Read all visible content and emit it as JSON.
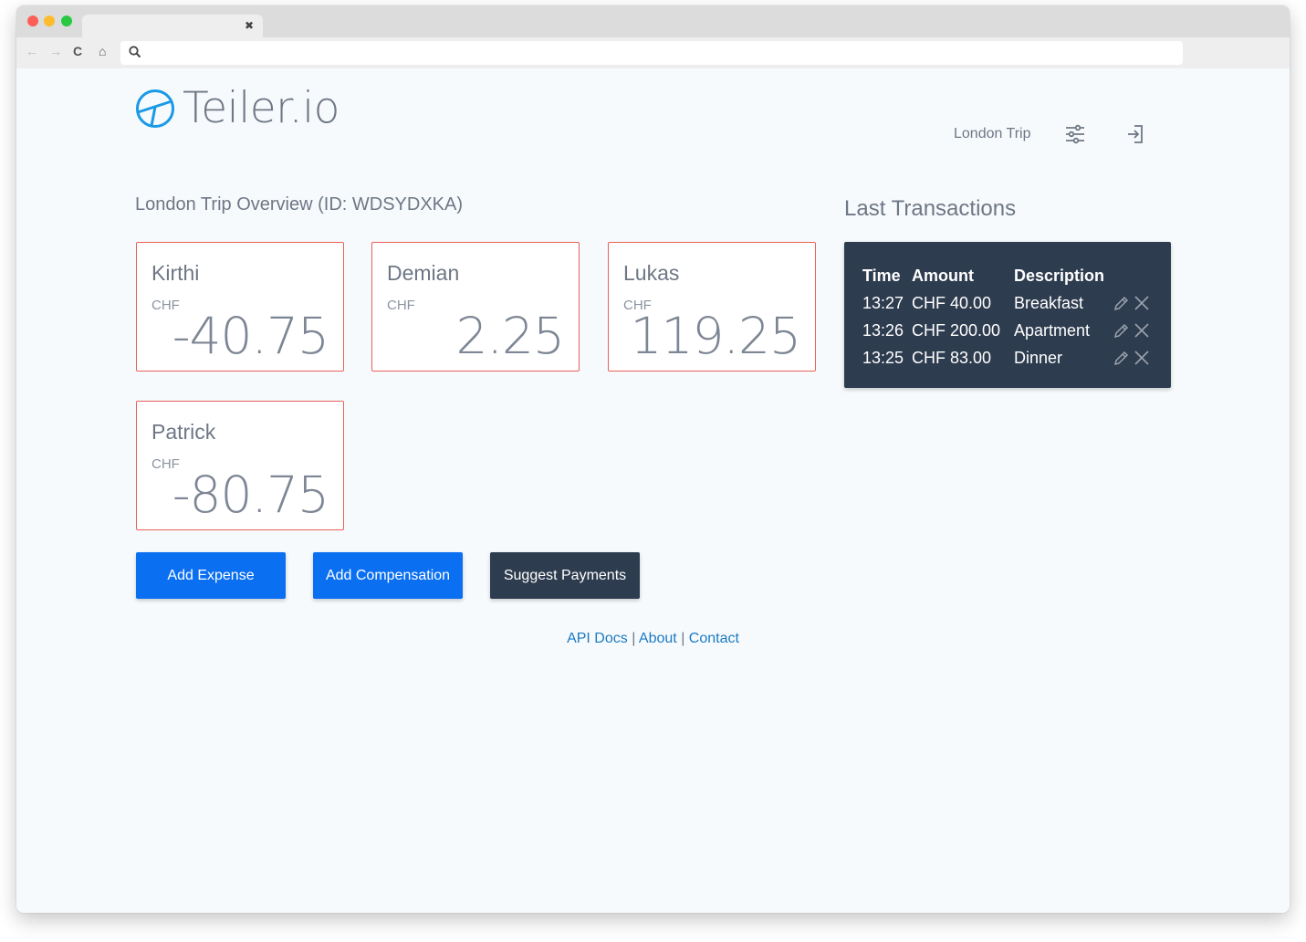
{
  "browser": {
    "tab_close": "✖",
    "nav_back": "←",
    "nav_forward": "→",
    "nav_reload": "C",
    "nav_home": "⌂"
  },
  "brand": {
    "name": "Teiler.io",
    "color": "#1a9ae6"
  },
  "nav": {
    "group_name": "London Trip",
    "settings_icon": "sliders-icon",
    "exit_icon": "exit-icon"
  },
  "overview": {
    "title": "London Trip Overview (ID: WDSYDXKA)",
    "members": [
      {
        "name": "Kirthi",
        "currency": "CHF",
        "balance": "-40.75"
      },
      {
        "name": "Demian",
        "currency": "CHF",
        "balance": "2.25"
      },
      {
        "name": "Lukas",
        "currency": "CHF",
        "balance": "119.25"
      },
      {
        "name": "Patrick",
        "currency": "CHF",
        "balance": "-80.75"
      }
    ]
  },
  "transactions": {
    "title": "Last Transactions",
    "headers": {
      "time": "Time",
      "amount": "Amount",
      "description": "Description"
    },
    "rows": [
      {
        "time": "13:27",
        "amount": "CHF 40.00",
        "description": "Breakfast"
      },
      {
        "time": "13:26",
        "amount": "CHF 200.00",
        "description": "Apartment"
      },
      {
        "time": "13:25",
        "amount": "CHF 83.00",
        "description": "Dinner"
      }
    ]
  },
  "actions": {
    "add_expense": "Add Expense",
    "add_compensation": "Add Compensation",
    "suggest_payments": "Suggest Payments"
  },
  "footer": {
    "api_docs": "API Docs",
    "about": "About",
    "contact": "Contact",
    "separator": "|"
  },
  "colors": {
    "primary": "#0b6ff2",
    "dark": "#2e3c4f",
    "card_border": "#e8605a",
    "link": "#1b7ac2"
  }
}
